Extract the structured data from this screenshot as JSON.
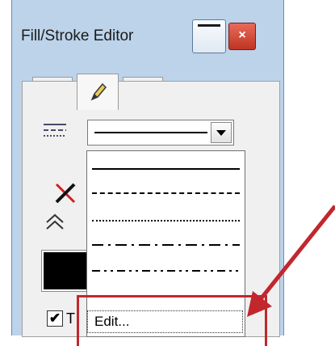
{
  "window": {
    "title": "Fill/Stroke Editor",
    "close_symbol": "×"
  },
  "tabs": [
    {
      "icon": "paint-bucket-icon"
    },
    {
      "icon": "pencil-icon",
      "selected": true
    },
    {
      "icon": "marker-icon"
    }
  ],
  "line_style": {
    "dropdown_open": true,
    "options": [
      "solid",
      "long-dash",
      "dotted",
      "dash-dot",
      "dash-dot-dot"
    ],
    "edit_label": "Edit..."
  },
  "checkbox": {
    "checked": true,
    "mark": "✔",
    "label_partial": "T"
  },
  "colors": {
    "accent": "#c1272d",
    "window_bg": "#bcd3ea",
    "swatch": "#000000"
  }
}
